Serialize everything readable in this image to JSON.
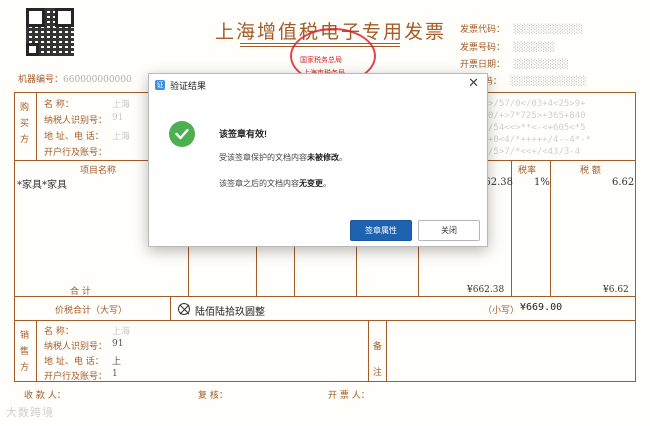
{
  "invoice": {
    "title": "上海增值税电子专用发票",
    "seal_line1": "国家税务总局",
    "seal_line2": "上海市税务局",
    "machine_no_label": "机器编号：",
    "machine_no": "66",
    "code_label": "发票代码：",
    "number_label": "发票号码：",
    "date_label": "开票日期：",
    "check_label": "校 验 码：",
    "buyer": {
      "side_label": [
        "购",
        "买",
        "方"
      ],
      "name_label": "名          称：",
      "tax_id_label": "纳税人识别号：",
      "address_label": "地 址、电 话：",
      "bank_label": "开户行及账号：",
      "name_value": "上海",
      "tax_id_value": "91",
      "address_value": "上海",
      "bank_value": ""
    },
    "password_area": [
      ">/57/0</03+4<25>9+",
      "0/+>7*725>+365+840",
      "/54<<>**<-<+605<*5",
      "+0<4/*+++++/4--4*-*",
      "/5>7/*<<+/<43/3-4"
    ],
    "items_header": {
      "name": "项目名称",
      "rate": "税率",
      "tax": "税    额"
    },
    "items": [
      {
        "name": "*家具*家具",
        "amount": "662.38",
        "rate": "1%",
        "tax": "6.62"
      }
    ],
    "subtotal_label": "合          计",
    "subtotal_amount": "¥662.38",
    "subtotal_tax": "¥6.62",
    "total_label": "价税合计（大写）",
    "total_words": "陆佰陆拾玖圆整",
    "total_small_label": "（小写）",
    "total_small": "¥669.00",
    "seller": {
      "side_label": [
        "销",
        "售",
        "方"
      ],
      "name_label": "名          称：",
      "tax_id_label": "纳税人识别号：",
      "address_label": "地 址、电 话：",
      "bank_label": "开户行及账号：",
      "name_value": "上海",
      "tax_id_value": "91",
      "address_value": "上",
      "bank_value": "1"
    },
    "remarks_label": [
      "备",
      "注"
    ],
    "payee_label": "收 款 人：",
    "reviewer_label": "复   核：",
    "issuer_label": "开 票 人：",
    "watermark": "大数跨境"
  },
  "dialog": {
    "title": "验证结果",
    "app_icon_text": "证",
    "close_glyph": "✕",
    "heading": "该签章有效!",
    "line1_pre": "受该签章保护的文档内容",
    "line1_bold": "未被修改",
    "line1_post": "。",
    "line2_pre": "该签章之后的文档内容",
    "line2_bold": "无变更",
    "line2_post": "。",
    "primary_button": "签章属性",
    "secondary_button": "关闭",
    "colors": {
      "primary": "#1e63b0",
      "success": "#4caf50"
    }
  },
  "icons": [
    "check-circle-icon",
    "close-icon",
    "app-icon",
    "circle-x-icon",
    "qr-code"
  ]
}
